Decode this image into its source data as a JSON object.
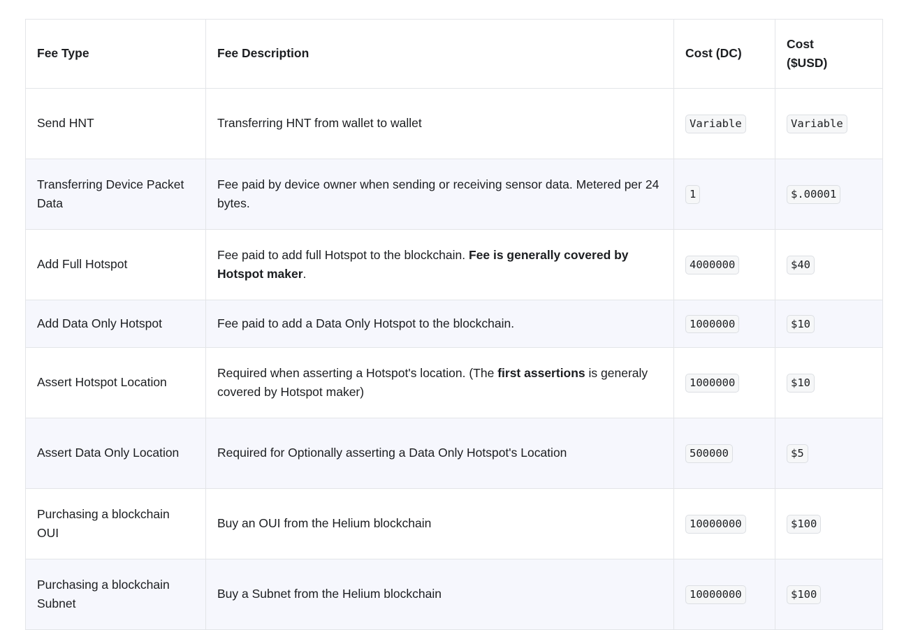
{
  "table": {
    "headers": {
      "fee_type": "Fee Type",
      "fee_description": "Fee Description",
      "cost_dc": "Cost (DC)",
      "cost_usd_line1": "Cost",
      "cost_usd_line2": "($USD)"
    },
    "rows": [
      {
        "fee_type": "Send HNT",
        "desc_before": "Transferring HNT from wallet to wallet",
        "desc_bold": "",
        "desc_after": "",
        "cost_dc": "Variable",
        "cost_usd": "Variable"
      },
      {
        "fee_type": "Transferring Device Packet Data",
        "desc_before": "Fee paid by device owner when sending or receiving sensor data. Metered per 24 bytes.",
        "desc_bold": "",
        "desc_after": "",
        "cost_dc": "1",
        "cost_usd": "$.00001"
      },
      {
        "fee_type": "Add Full Hotspot",
        "desc_before": "Fee paid to add full Hotspot to the blockchain. ",
        "desc_bold": "Fee is generally covered by Hotspot maker",
        "desc_after": ".",
        "cost_dc": "4000000",
        "cost_usd": "$40"
      },
      {
        "fee_type": "Add Data Only Hotspot",
        "desc_before": "Fee paid to add a Data Only Hotspot to the blockchain.",
        "desc_bold": "",
        "desc_after": "",
        "cost_dc": "1000000",
        "cost_usd": "$10"
      },
      {
        "fee_type": "Assert Hotspot Location",
        "desc_before": "Required when asserting a Hotspot's location. (The ",
        "desc_bold": "first assertions",
        "desc_after": " is generaly covered by Hotspot maker)",
        "cost_dc": "1000000",
        "cost_usd": "$10"
      },
      {
        "fee_type": "Assert Data Only Location",
        "desc_before": "Required for Optionally asserting a Data Only Hotspot's Location",
        "desc_bold": "",
        "desc_after": "",
        "cost_dc": "500000",
        "cost_usd": "$5"
      },
      {
        "fee_type": "Purchasing a blockchain OUI",
        "desc_before": "Buy an OUI from the Helium blockchain",
        "desc_bold": "",
        "desc_after": "",
        "cost_dc": "10000000",
        "cost_usd": "$100"
      },
      {
        "fee_type": "Purchasing a blockchain Subnet",
        "desc_before": "Buy a Subnet from the Helium blockchain",
        "desc_bold": "",
        "desc_after": "",
        "cost_dc": "10000000",
        "cost_usd": "$100"
      }
    ]
  }
}
